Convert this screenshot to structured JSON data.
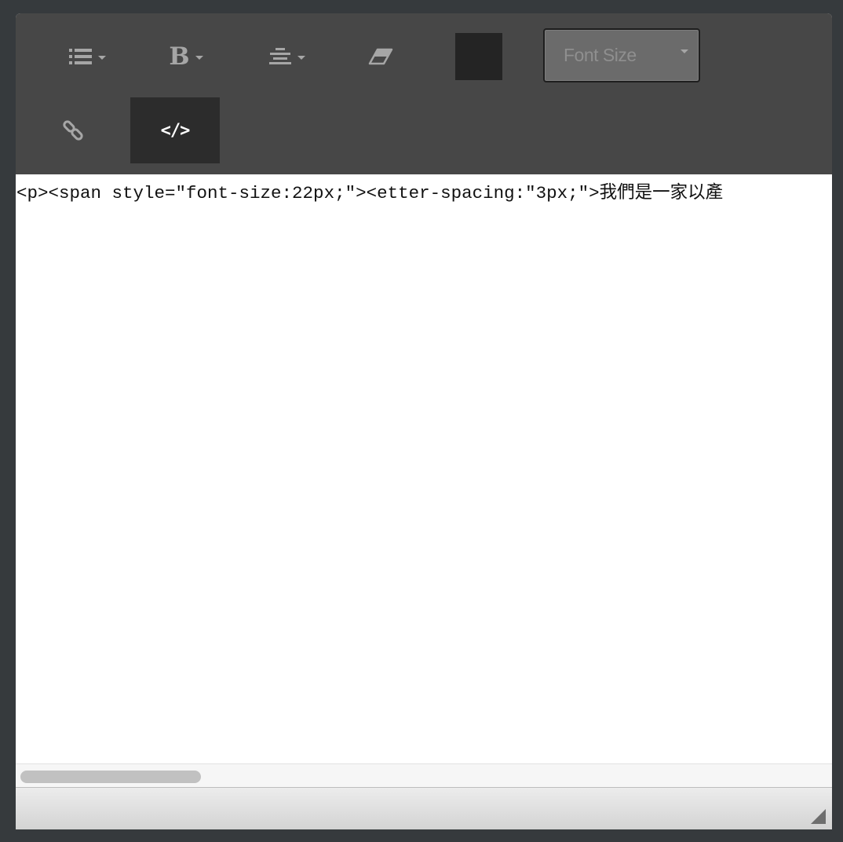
{
  "toolbar": {
    "row1": [
      {
        "name": "list-style-button",
        "icon": "unordered-list-icon",
        "has_caret": true
      },
      {
        "name": "bold-button",
        "icon": "bold-icon",
        "glyph": "B",
        "has_caret": true
      },
      {
        "name": "align-button",
        "icon": "align-center-icon",
        "has_caret": true
      },
      {
        "name": "eraser-button",
        "icon": "eraser-icon",
        "has_caret": false
      }
    ],
    "color_swatch": {
      "color": "#242424"
    },
    "font_size": {
      "label": "Font Size"
    },
    "row2": [
      {
        "name": "link-button",
        "icon": "link-icon"
      },
      {
        "name": "code-view-button",
        "icon": "code-icon",
        "glyph": "</>",
        "active": true
      }
    ]
  },
  "code_editor": {
    "line1": "<p><span style=\"font-size:22px;\"><etter-spacing:\"3px;\">我們是一家以產"
  },
  "colors": {
    "page_bg": "#363a3d",
    "toolbar_bg": "#474747",
    "icon": "#a6a6a6",
    "active_button": "#2c2c2c"
  }
}
